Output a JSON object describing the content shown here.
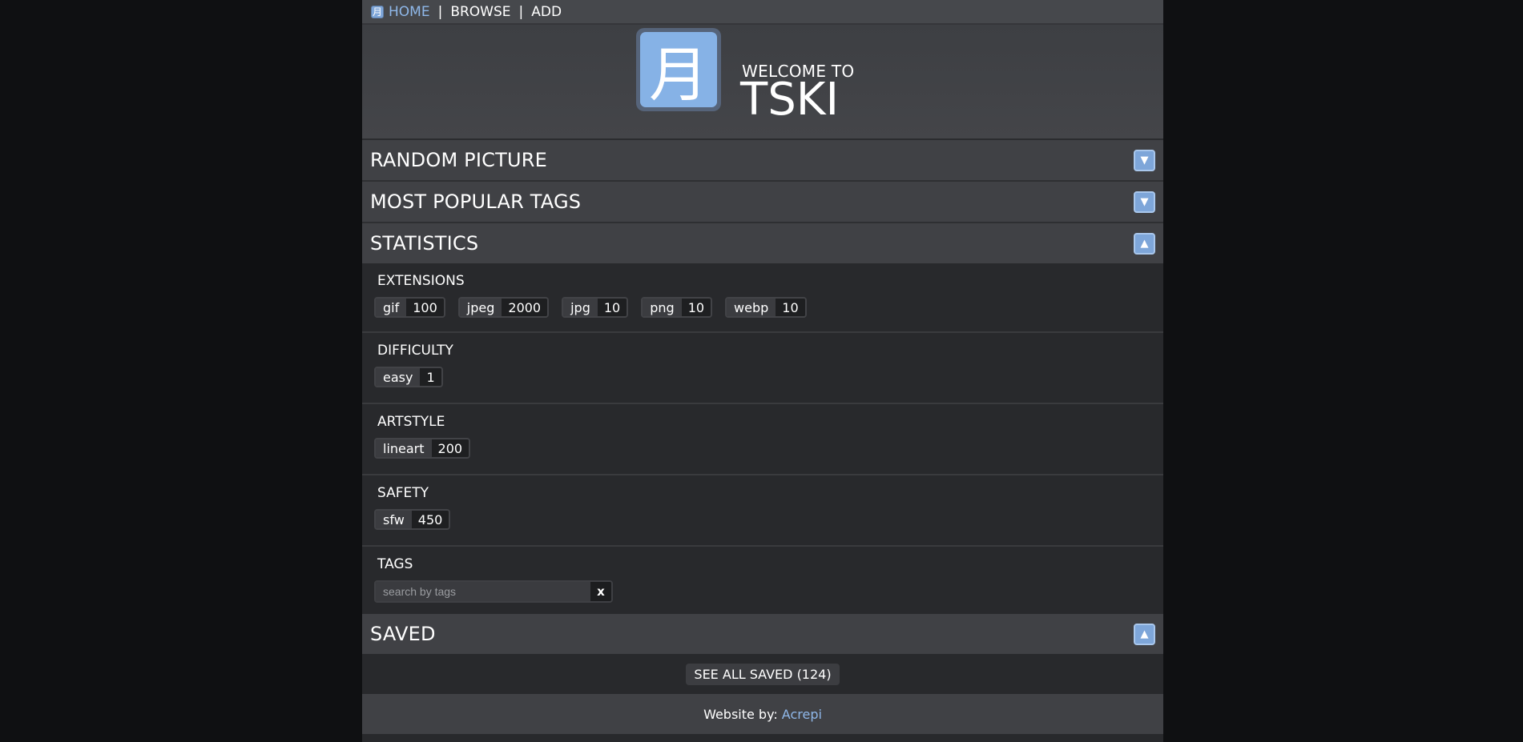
{
  "nav": {
    "logo_glyph": "月",
    "links": [
      {
        "label": "HOME",
        "active": true
      },
      {
        "label": "BROWSE",
        "active": false
      },
      {
        "label": "ADD",
        "active": false
      }
    ],
    "separator": "|"
  },
  "hero": {
    "logo_glyph": "月",
    "welcome": "WELCOME TO",
    "brand": "TSKI"
  },
  "sections": {
    "random": {
      "title": "RANDOM PICTURE",
      "toggle": "▼"
    },
    "popular": {
      "title": "MOST POPULAR TAGS",
      "toggle": "▼"
    },
    "stats": {
      "title": "STATISTICS",
      "toggle": "▲"
    },
    "saved": {
      "title": "SAVED",
      "toggle": "▲"
    }
  },
  "stats": {
    "extensions": {
      "label": "EXTENSIONS",
      "items": [
        {
          "k": "gif",
          "v": "100"
        },
        {
          "k": "jpeg",
          "v": "2000"
        },
        {
          "k": "jpg",
          "v": "10"
        },
        {
          "k": "png",
          "v": "10"
        },
        {
          "k": "webp",
          "v": "10"
        }
      ]
    },
    "difficulty": {
      "label": "DIFFICULTY",
      "items": [
        {
          "k": "easy",
          "v": "1"
        }
      ]
    },
    "artstyle": {
      "label": "ARTSTYLE",
      "items": [
        {
          "k": "lineart",
          "v": "200"
        }
      ]
    },
    "safety": {
      "label": "SAFETY",
      "items": [
        {
          "k": "sfw",
          "v": "450"
        }
      ]
    },
    "tags": {
      "label": "TAGS",
      "placeholder": "search by tags",
      "clear": "x"
    }
  },
  "saved": {
    "button": "SEE ALL SAVED (124)"
  },
  "footer": {
    "text": "Website by:",
    "author": "Acrepi"
  },
  "colors": {
    "accent": "#7ea6d9",
    "link": "#8fb8ea",
    "page_bg": "#0f1012",
    "panel_bg": "#28292c"
  }
}
